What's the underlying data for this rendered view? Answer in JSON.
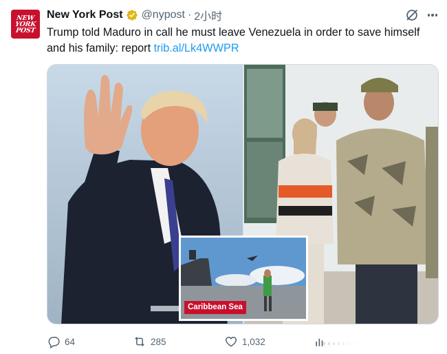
{
  "account": {
    "avatar_text": [
      "NEW",
      "YORK",
      "POST"
    ],
    "name": "New York Post",
    "handle": "@nypost",
    "separator": "·",
    "time": "2小时",
    "verified_icon": "gold-verified-badge-icon"
  },
  "tweet": {
    "text": "Trump told Maduro in call he must leave Venezuela in order to save himself and his family: report ",
    "link": "trib.al/Lk4WWPR"
  },
  "media": {
    "inset_label": "Caribbean Sea"
  },
  "actions": {
    "replies": "64",
    "retweets": "285",
    "likes": "1,032"
  },
  "colors": {
    "brand_red": "#c8102e",
    "link_blue": "#1d9bf0",
    "muted": "#536471",
    "verified_gold": "#e2b719"
  }
}
